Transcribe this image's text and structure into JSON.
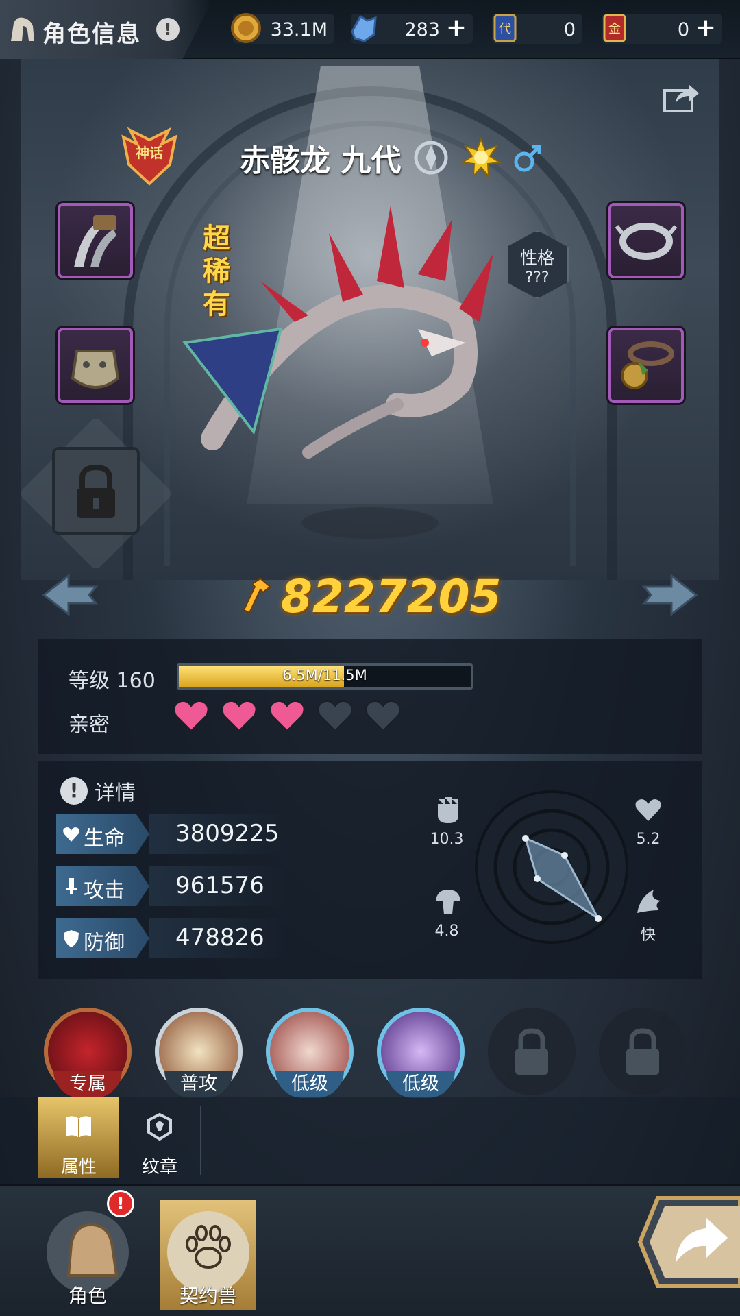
{
  "header": {
    "title": "角色信息",
    "alert_icon": "!",
    "currencies": [
      {
        "icon": "gold-coin-icon",
        "value": "33.1M",
        "has_plus": false
      },
      {
        "icon": "crystal-gem-icon",
        "value": "283",
        "has_plus": true
      },
      {
        "icon": "blue-card-icon",
        "icon_text": "代",
        "value": "0",
        "has_plus": false
      },
      {
        "icon": "red-card-icon",
        "icon_text": "金",
        "value": "0",
        "has_plus": true
      }
    ],
    "plus_label": "+"
  },
  "pet": {
    "grade_badge": "神话",
    "name": "赤骸龙 九代",
    "rarity": "超稀有",
    "personality_label": "性格",
    "personality_value": "???",
    "power": "8227205"
  },
  "level": {
    "label": "等级 160",
    "xp_text": "6.5M/11.5M",
    "xp_fraction": 0.565,
    "intimacy_label": "亲密",
    "hearts_filled": 3,
    "hearts_total": 5
  },
  "stats": {
    "detail_label": "详情",
    "rows": [
      {
        "label": "生命",
        "value": "3809225"
      },
      {
        "label": "攻击",
        "value": "961576"
      },
      {
        "label": "防御",
        "value": "478826"
      }
    ],
    "radar": {
      "top_left": "10.3",
      "top_right": "5.2",
      "bottom_left": "4.8",
      "bottom_right": "快"
    }
  },
  "skills": [
    {
      "label": "专属",
      "locked": false
    },
    {
      "label": "普攻",
      "locked": false
    },
    {
      "label": "低级",
      "locked": false
    },
    {
      "label": "低级",
      "locked": false
    },
    {
      "label": "",
      "locked": true
    },
    {
      "label": "",
      "locked": true
    }
  ],
  "tabs": [
    {
      "label": "属性",
      "active": true
    },
    {
      "label": "纹章",
      "active": false
    }
  ],
  "bottom_nav": [
    {
      "label": "角色",
      "active": false
    },
    {
      "label": "契约兽",
      "active": true
    }
  ],
  "colors": {
    "power": "#ffd23c",
    "heart_filled": "#f05a94",
    "heart_empty": "#3a4450",
    "equip_border": "#a15ab8",
    "xp_fill": "#e6b934"
  }
}
